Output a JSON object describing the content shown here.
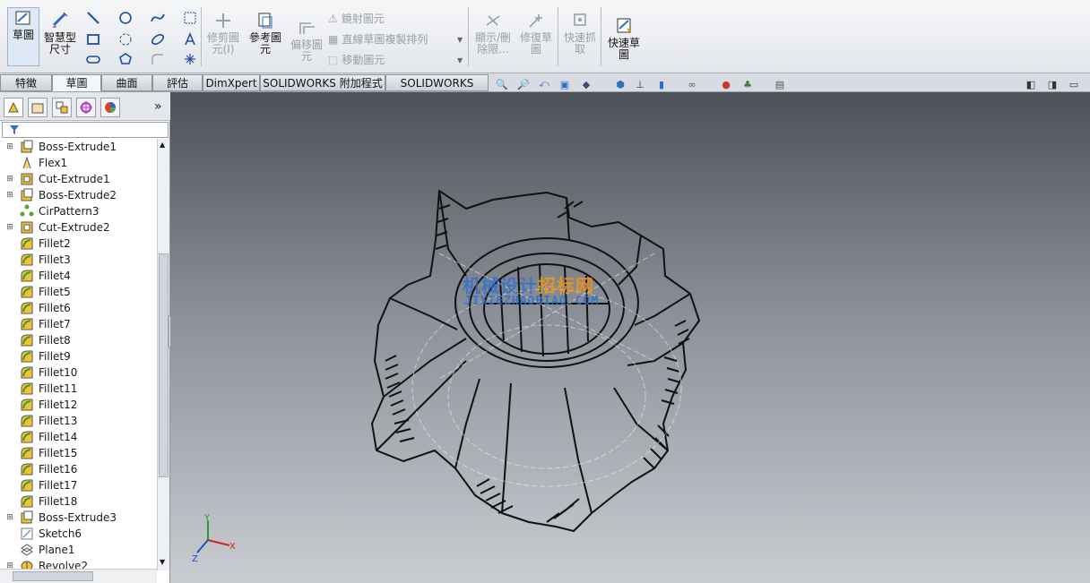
{
  "ribbon": {
    "sketch": "草圖",
    "smart_dimension": "智慧型\n尺寸",
    "trim": "修剪圖\n元(I)",
    "convert": "參考圖\n元",
    "offset": "偏移圖\n元",
    "mirror": "鏡射圖元",
    "linear_pattern": "直線草圖複製排列",
    "move": "移動圖元",
    "display_delete": "顯示/刪\n除限...",
    "repair": "修復草\n圖",
    "quick_snaps": "快速抓\n取",
    "rapid_sketch": "快速草\n圖"
  },
  "tabs": [
    "特徵",
    "草圖",
    "曲面",
    "評估",
    "DimXpert",
    "SOLIDWORKS 附加程式",
    "SOLIDWORKS MBD"
  ],
  "active_tab": "草圖",
  "tree": [
    {
      "label": "Boss-Extrude1",
      "icon": "extrude-icon",
      "expandable": true
    },
    {
      "label": "Flex1",
      "icon": "flex-icon",
      "expandable": false
    },
    {
      "label": "Cut-Extrude1",
      "icon": "cut-icon",
      "expandable": true
    },
    {
      "label": "Boss-Extrude2",
      "icon": "extrude-icon",
      "expandable": true
    },
    {
      "label": "CirPattern3",
      "icon": "pattern-icon",
      "expandable": false
    },
    {
      "label": "Cut-Extrude2",
      "icon": "cut-icon",
      "expandable": true
    },
    {
      "label": "Fillet2",
      "icon": "fillet-icon",
      "expandable": false
    },
    {
      "label": "Fillet3",
      "icon": "fillet-icon",
      "expandable": false
    },
    {
      "label": "Fillet4",
      "icon": "fillet-icon",
      "expandable": false
    },
    {
      "label": "Fillet5",
      "icon": "fillet-icon",
      "expandable": false
    },
    {
      "label": "Fillet6",
      "icon": "fillet-icon",
      "expandable": false
    },
    {
      "label": "Fillet7",
      "icon": "fillet-icon",
      "expandable": false
    },
    {
      "label": "Fillet8",
      "icon": "fillet-icon",
      "expandable": false
    },
    {
      "label": "Fillet9",
      "icon": "fillet-icon",
      "expandable": false
    },
    {
      "label": "Fillet10",
      "icon": "fillet-icon",
      "expandable": false
    },
    {
      "label": "Fillet11",
      "icon": "fillet-icon",
      "expandable": false
    },
    {
      "label": "Fillet12",
      "icon": "fillet-icon",
      "expandable": false
    },
    {
      "label": "Fillet13",
      "icon": "fillet-icon",
      "expandable": false
    },
    {
      "label": "Fillet14",
      "icon": "fillet-icon",
      "expandable": false
    },
    {
      "label": "Fillet15",
      "icon": "fillet-icon",
      "expandable": false
    },
    {
      "label": "Fillet16",
      "icon": "fillet-icon",
      "expandable": false
    },
    {
      "label": "Fillet17",
      "icon": "fillet-icon",
      "expandable": false
    },
    {
      "label": "Fillet18",
      "icon": "fillet-icon",
      "expandable": false
    },
    {
      "label": "Boss-Extrude3",
      "icon": "extrude-icon",
      "expandable": true
    },
    {
      "label": "Sketch6",
      "icon": "sketch-icon",
      "expandable": false
    },
    {
      "label": "Plane1",
      "icon": "plane-icon",
      "expandable": false
    },
    {
      "label": "Revolve2",
      "icon": "revolve-icon",
      "expandable": true
    }
  ],
  "watermark": {
    "line1a": "机械设计",
    "line1b": "招标网",
    "line2": "JIXIEZHAOBIAO.COM"
  },
  "triad": {
    "x": "X",
    "y": "Y",
    "z": "Z"
  },
  "panel_more": "»",
  "colors": {
    "accent": "#2f6fbf",
    "fillet": "#f2c233",
    "viewport_top": "#4e5157",
    "viewport_bottom": "#c9ccd1"
  }
}
